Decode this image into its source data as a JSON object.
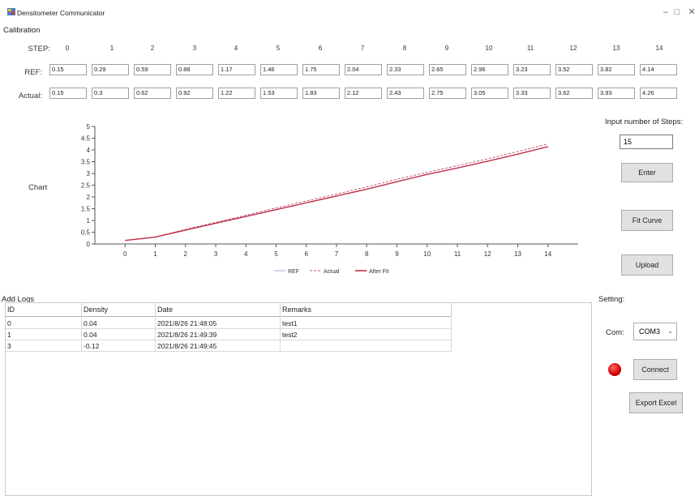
{
  "window": {
    "title": "Densitometer Communicator",
    "min_icon": "minimize-icon",
    "max_icon": "maximize-icon",
    "close_icon": "close-icon"
  },
  "calibration": {
    "section_label": "Calibration",
    "step_label": "STEP:",
    "ref_label": "REF:",
    "actual_label": "Actual:",
    "steps": [
      "0",
      "1",
      "2",
      "3",
      "4",
      "5",
      "6",
      "7",
      "8",
      "9",
      "10",
      "11",
      "12",
      "13",
      "14"
    ],
    "ref": [
      "0.15",
      "0.29",
      "0.59",
      "0.88",
      "1.17",
      "1.46",
      "1.75",
      "2.04",
      "2.33",
      "2.65",
      "2.96",
      "3.23",
      "3.52",
      "3.82",
      "4.14"
    ],
    "actual": [
      "0.15",
      "0.3",
      "0.62",
      "0.92",
      "1.22",
      "1.53",
      "1.83",
      "2.12",
      "2.43",
      "2.75",
      "3.05",
      "3.33",
      "3.62",
      "3.93",
      "4.26"
    ]
  },
  "chart": {
    "label": "Chart"
  },
  "chart_data": {
    "type": "line",
    "x": [
      0,
      1,
      2,
      3,
      4,
      5,
      6,
      7,
      8,
      9,
      10,
      11,
      12,
      13,
      14
    ],
    "xlim": [
      -1,
      15
    ],
    "ylim": [
      0,
      5
    ],
    "x_ticks": [
      "0",
      "1",
      "2",
      "3",
      "4",
      "5",
      "6",
      "7",
      "8",
      "9",
      "10",
      "11",
      "12",
      "13",
      "14"
    ],
    "y_ticks": [
      "0",
      "0.5",
      "1",
      "1.5",
      "2",
      "2.5",
      "3",
      "3.5",
      "4",
      "4.5",
      "5"
    ],
    "legend_position": "bottom",
    "series": [
      {
        "name": "REF",
        "style": "solid",
        "color": "#a3a8d6",
        "values": [
          0.15,
          0.29,
          0.59,
          0.88,
          1.17,
          1.46,
          1.75,
          2.04,
          2.33,
          2.65,
          2.96,
          3.23,
          3.52,
          3.82,
          4.14
        ]
      },
      {
        "name": "Actual",
        "style": "dashed",
        "color": "#c05a7a",
        "values": [
          0.15,
          0.3,
          0.62,
          0.92,
          1.22,
          1.53,
          1.83,
          2.12,
          2.43,
          2.75,
          3.05,
          3.33,
          3.62,
          3.93,
          4.26
        ]
      },
      {
        "name": "After Fit",
        "style": "solid",
        "color": "#c0304a",
        "values": [
          0.15,
          0.29,
          0.59,
          0.88,
          1.17,
          1.46,
          1.75,
          2.04,
          2.33,
          2.65,
          2.96,
          3.23,
          3.52,
          3.82,
          4.14
        ]
      }
    ]
  },
  "controls": {
    "steps_label": "Input number of Steps:",
    "steps_value": "15",
    "enter_label": "Enter",
    "fit_label": "Fit Curve",
    "upload_label": "Upload"
  },
  "logs": {
    "section_label": "Add Logs",
    "columns": [
      "ID",
      "Density",
      "Date",
      "Remarks"
    ],
    "rows": [
      [
        "0",
        "0.04",
        "2021/8/26 21:48:05",
        "test1"
      ],
      [
        "1",
        "0.04",
        "2021/8/26 21:49:39",
        "test2"
      ],
      [
        "3",
        "-0.12",
        "2021/8/26 21:49:45",
        ""
      ]
    ]
  },
  "setting": {
    "section_label": "Setting:",
    "com_label": "Com:",
    "com_value": "COM3",
    "connect_label": "Connect",
    "export_label": "Export Excel",
    "led_color": "#d00000"
  }
}
